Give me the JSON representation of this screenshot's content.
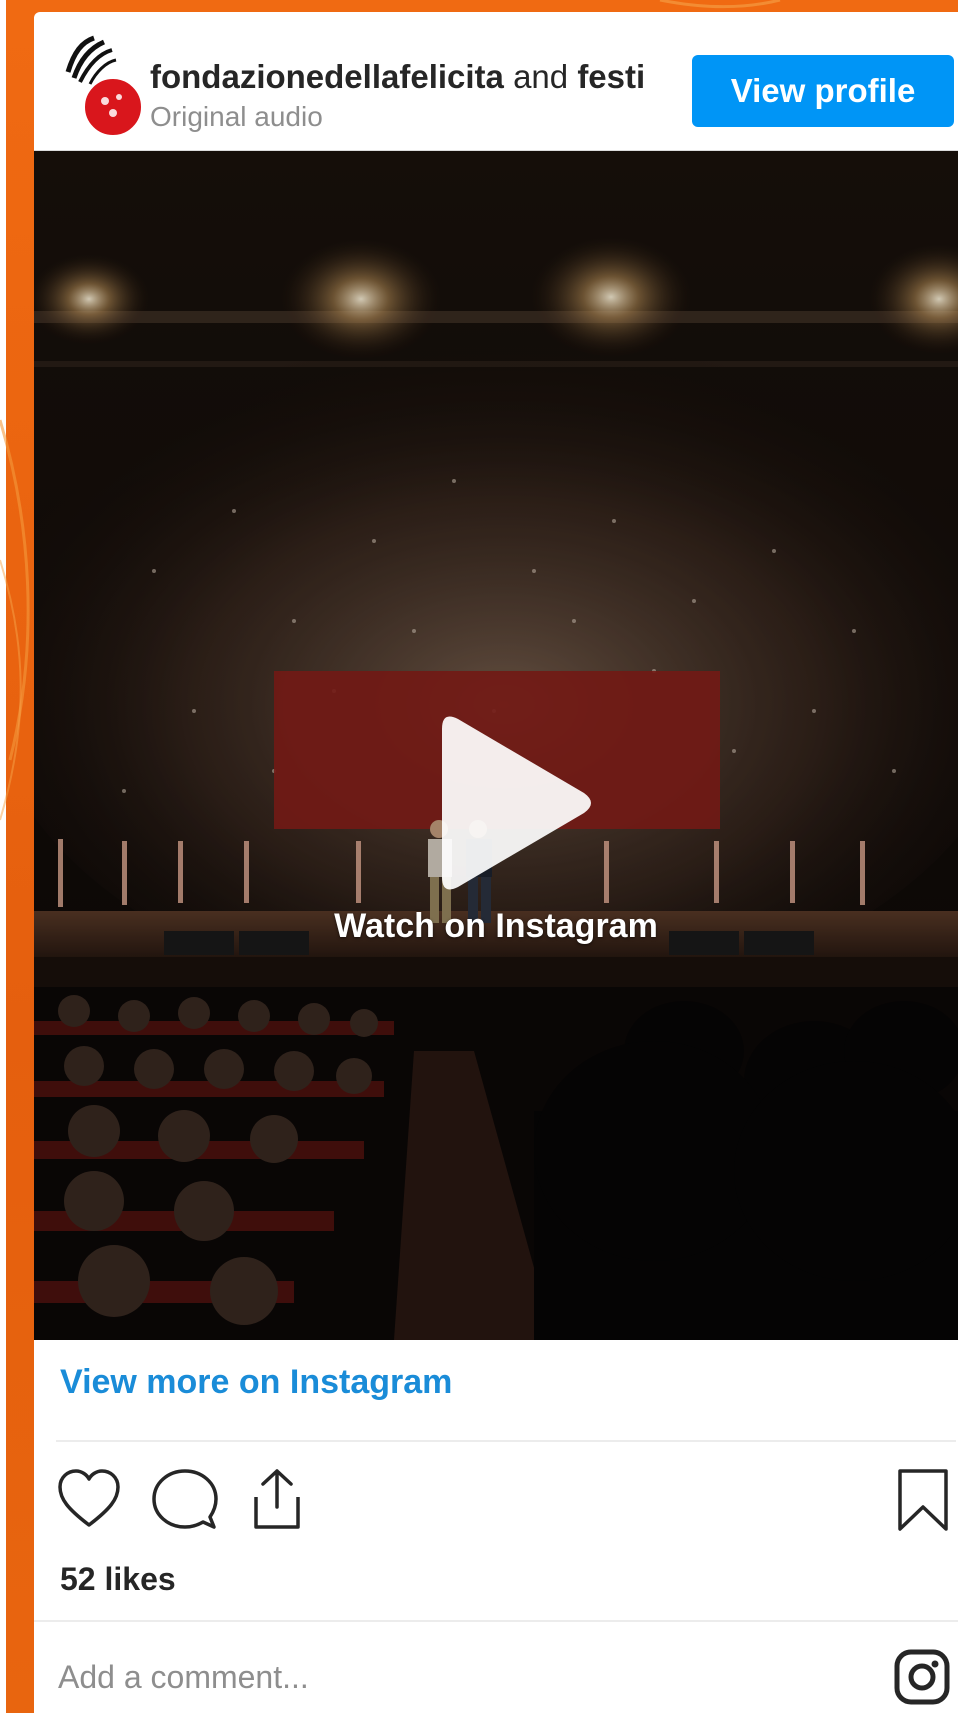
{
  "colors": {
    "page_background": "#e8630f",
    "card_background": "#ffffff",
    "accent_blue": "#0095f6",
    "link_blue": "#1a8cd8",
    "text_primary": "#262626",
    "text_secondary": "#8e8e8e",
    "avatar_red": "#d9161c"
  },
  "header": {
    "account_primary": "fondazionedellafelicita",
    "connector": " and ",
    "account_secondary": "festi",
    "subtitle": "Original audio",
    "view_profile_label": "View profile",
    "avatar_icon": "collab-avatar-icon"
  },
  "media": {
    "watch_label": "Watch on Instagram",
    "play_icon": "play-icon"
  },
  "footer": {
    "view_more_label": "View more on Instagram",
    "like_icon": "heart-icon",
    "comment_icon": "comment-icon",
    "share_icon": "share-icon",
    "save_icon": "bookmark-icon",
    "likes_text": "52 likes",
    "comment_placeholder": "Add a comment...",
    "instagram_icon": "instagram-icon"
  }
}
